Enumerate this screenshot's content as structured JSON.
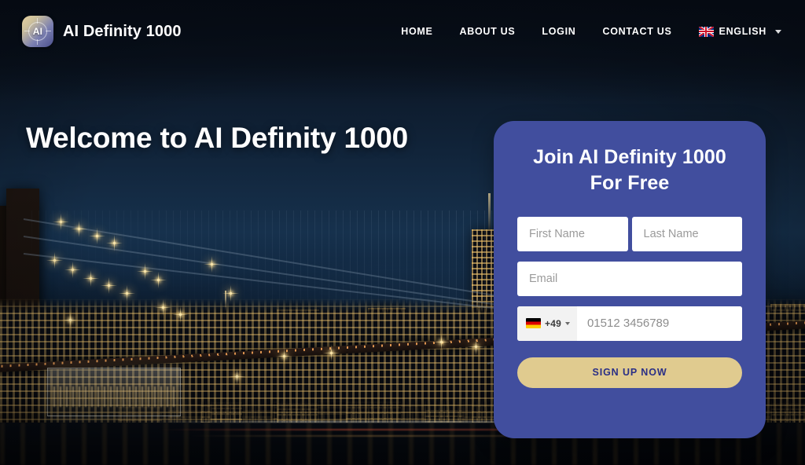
{
  "brand": {
    "logo_icon": "ai-target-logo-icon",
    "logo_text": "AI",
    "name": "AI Definity 1000"
  },
  "nav": {
    "items": [
      {
        "label": "HOME"
      },
      {
        "label": "ABOUT US"
      },
      {
        "label": "LOGIN"
      },
      {
        "label": "CONTACT US"
      }
    ],
    "language": {
      "label": "ENGLISH",
      "flag_icon": "uk-flag-icon",
      "caret_icon": "chevron-down-icon"
    }
  },
  "hero": {
    "title": "Welcome to AI Definity 1000"
  },
  "signup": {
    "title": "Join AI Definity 1000 For Free",
    "first_name": {
      "value": "",
      "placeholder": "First Name"
    },
    "last_name": {
      "value": "",
      "placeholder": "Last Name"
    },
    "email": {
      "value": "",
      "placeholder": "Email"
    },
    "phone": {
      "country_flag_icon": "germany-flag-icon",
      "dial_code": "+49",
      "caret_icon": "chevron-down-icon",
      "value": "",
      "placeholder": "01512 3456789"
    },
    "submit_label": "SIGN UP NOW"
  },
  "colors": {
    "panel_bg": "#414e9e",
    "cta_bg": "#e0cb8f",
    "cta_text": "#2a2f86",
    "nav_text": "#ffffff",
    "page_bg": "#0a121e"
  }
}
